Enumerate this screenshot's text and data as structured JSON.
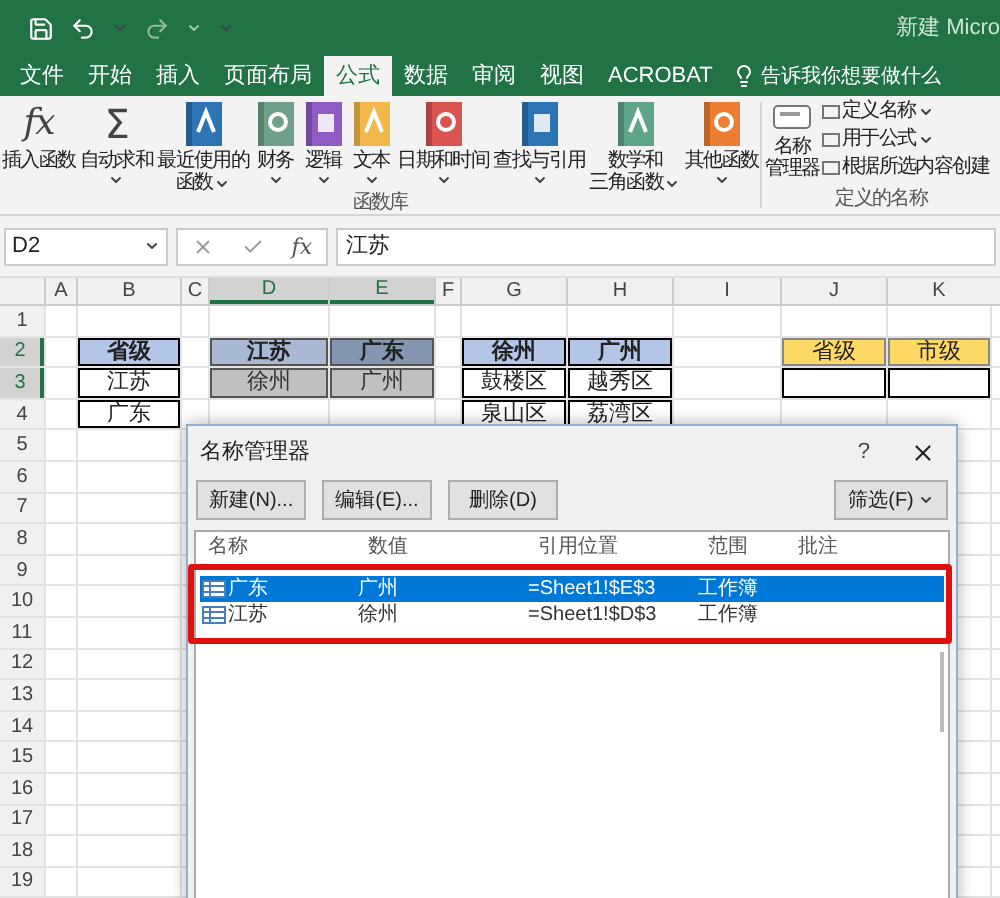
{
  "window": {
    "title": "新建 Micro"
  },
  "tabs": [
    {
      "label": "文件",
      "selected": false
    },
    {
      "label": "开始",
      "selected": false
    },
    {
      "label": "插入",
      "selected": false
    },
    {
      "label": "页面布局",
      "selected": false
    },
    {
      "label": "公式",
      "selected": true
    },
    {
      "label": "数据",
      "selected": false
    },
    {
      "label": "审阅",
      "selected": false
    },
    {
      "label": "视图",
      "selected": false
    },
    {
      "label": "ACROBAT",
      "selected": false
    }
  ],
  "tell_me": "告诉我你想要做什么",
  "ribbon": {
    "function_library": {
      "label": "函数库",
      "buttons": [
        {
          "kind": "fx",
          "glyph": "fx",
          "lines": [
            "插入函数"
          ],
          "dropdown": false
        },
        {
          "kind": "sum",
          "glyph": "Σ",
          "lines": [
            "自动求和"
          ],
          "dropdown": true
        },
        {
          "kind": "book",
          "color": "#2e75b6",
          "lines": [
            "最近使用的",
            "函数"
          ],
          "dropdown": true
        },
        {
          "kind": "book",
          "color": "#70a08a",
          "lines": [
            "财务"
          ],
          "dropdown": true
        },
        {
          "kind": "book",
          "color": "#8e5cc4",
          "lines": [
            "逻辑"
          ],
          "dropdown": true
        },
        {
          "kind": "book",
          "color": "#f2b84b",
          "lines": [
            "文本"
          ],
          "dropdown": true
        },
        {
          "kind": "book",
          "color": "#d9534f",
          "lines": [
            "日期和时间"
          ],
          "dropdown": true
        },
        {
          "kind": "book",
          "color": "#2e75b6",
          "lines": [
            "查找与引用"
          ],
          "dropdown": true
        },
        {
          "kind": "book",
          "color": "#5fa58a",
          "lines": [
            "数学和",
            "三角函数"
          ],
          "dropdown": true
        },
        {
          "kind": "book",
          "color": "#ed7d31",
          "lines": [
            "其他函数"
          ],
          "dropdown": true
        }
      ]
    },
    "defined_names": {
      "label": "定义的名称",
      "manager": {
        "lines": [
          "名称",
          "管理器"
        ]
      },
      "items": [
        {
          "label": "定义名称",
          "dropdown": true
        },
        {
          "label": "用于公式",
          "dropdown": true
        },
        {
          "label": "根据所选内容创建",
          "dropdown": false
        }
      ]
    }
  },
  "formula_bar": {
    "name_box": "D2",
    "fx": "fx",
    "formula": "江苏"
  },
  "columns": [
    {
      "label": "A",
      "selected": false
    },
    {
      "label": "B",
      "selected": false
    },
    {
      "label": "C",
      "selected": false
    },
    {
      "label": "D",
      "selected": true
    },
    {
      "label": "E",
      "selected": true
    },
    {
      "label": "F",
      "selected": false
    },
    {
      "label": "G",
      "selected": false
    },
    {
      "label": "H",
      "selected": false
    },
    {
      "label": "I",
      "selected": false
    },
    {
      "label": "J",
      "selected": false
    },
    {
      "label": "K",
      "selected": false
    }
  ],
  "rows": [
    {
      "number": "1",
      "selected": false
    },
    {
      "number": "2",
      "selected": true,
      "cells": [
        {
          "kind": "empty"
        },
        {
          "text": "省级",
          "kind": "header"
        },
        {
          "kind": "empty"
        },
        {
          "text": "江苏",
          "kind": "range_header"
        },
        {
          "text": "广东",
          "kind": "range_header_dark"
        },
        {
          "kind": "empty"
        },
        {
          "text": "徐州",
          "kind": "header"
        },
        {
          "text": "广州",
          "kind": "header"
        },
        {
          "kind": "empty"
        },
        {
          "text": "省级",
          "kind": "yellow"
        },
        {
          "text": "市级",
          "kind": "yellow"
        }
      ]
    },
    {
      "number": "3",
      "selected": true,
      "cells": [
        {
          "kind": "empty"
        },
        {
          "text": "江苏",
          "kind": "body"
        },
        {
          "kind": "empty"
        },
        {
          "text": "徐州",
          "kind": "range"
        },
        {
          "text": "广州",
          "kind": "range"
        },
        {
          "kind": "empty"
        },
        {
          "text": "鼓楼区",
          "kind": "body"
        },
        {
          "text": "越秀区",
          "kind": "body"
        },
        {
          "kind": "empty"
        },
        {
          "kind": "body"
        },
        {
          "kind": "body"
        }
      ]
    },
    {
      "number": "4",
      "selected": false,
      "cells": [
        {
          "kind": "empty"
        },
        {
          "text": "广东",
          "kind": "body"
        },
        {
          "kind": "empty"
        },
        {
          "kind": "empty"
        },
        {
          "kind": "empty"
        },
        {
          "kind": "empty"
        },
        {
          "text": "泉山区",
          "kind": "body"
        },
        {
          "text": "荔湾区",
          "kind": "body"
        }
      ]
    },
    {
      "number": "5",
      "selected": false
    },
    {
      "number": "6",
      "selected": false
    },
    {
      "number": "7",
      "selected": false
    },
    {
      "number": "8",
      "selected": false
    },
    {
      "number": "9",
      "selected": false
    },
    {
      "number": "10",
      "selected": false
    },
    {
      "number": "11",
      "selected": false
    },
    {
      "number": "12",
      "selected": false
    },
    {
      "number": "13",
      "selected": false
    },
    {
      "number": "14",
      "selected": false
    },
    {
      "number": "15",
      "selected": false
    },
    {
      "number": "16",
      "selected": false
    },
    {
      "number": "17",
      "selected": false
    },
    {
      "number": "18",
      "selected": false
    },
    {
      "number": "19",
      "selected": false
    }
  ],
  "dialog": {
    "title": "名称管理器",
    "help": "?",
    "buttons": [
      {
        "label": "新建(N)..."
      },
      {
        "label": "编辑(E)..."
      },
      {
        "label": "删除(D)"
      }
    ],
    "filter": {
      "label": "筛选(F)",
      "dropdown": true
    },
    "columns": [
      "名称",
      "数值",
      "引用位置",
      "范围",
      "批注"
    ],
    "names": [
      {
        "name": "广东",
        "value": "广州",
        "ref": "=Sheet1!$E$3",
        "scope": "工作簿",
        "selected": true
      },
      {
        "name": "江苏",
        "value": "徐州",
        "ref": "=Sheet1!$D$3",
        "scope": "工作簿",
        "selected": false
      }
    ]
  }
}
